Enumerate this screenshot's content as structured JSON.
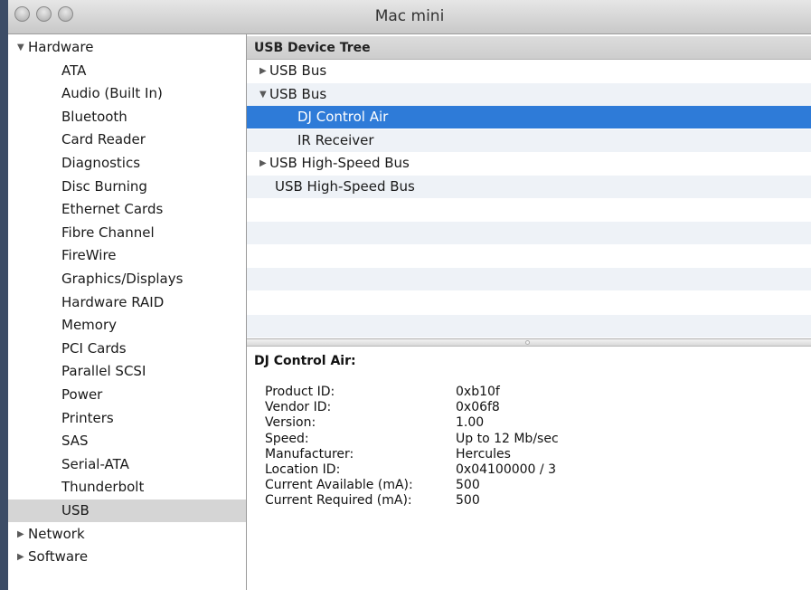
{
  "window": {
    "title": "Mac mini"
  },
  "sidebar": {
    "hardware_label": "Hardware",
    "hardware_items": [
      "ATA",
      "Audio (Built In)",
      "Bluetooth",
      "Card Reader",
      "Diagnostics",
      "Disc Burning",
      "Ethernet Cards",
      "Fibre Channel",
      "FireWire",
      "Graphics/Displays",
      "Hardware RAID",
      "Memory",
      "PCI Cards",
      "Parallel SCSI",
      "Power",
      "Printers",
      "SAS",
      "Serial-ATA",
      "Thunderbolt",
      "USB"
    ],
    "selected_item": "USB",
    "network_label": "Network",
    "software_label": "Software"
  },
  "tree": {
    "header": "USB Device Tree",
    "rows": [
      {
        "label": "USB Bus",
        "state": "collapsed"
      },
      {
        "label": "USB Bus",
        "state": "expanded"
      },
      {
        "label": "DJ Control Air",
        "state": "leaf"
      },
      {
        "label": "IR Receiver",
        "state": "leaf"
      },
      {
        "label": "USB High-Speed Bus",
        "state": "collapsed"
      },
      {
        "label": "USB High-Speed Bus",
        "state": "none"
      }
    ],
    "selected_index": 2
  },
  "detail": {
    "title": "DJ Control Air:",
    "properties": [
      {
        "key": "Product ID:",
        "value": "0xb10f"
      },
      {
        "key": "Vendor ID:",
        "value": "0x06f8"
      },
      {
        "key": "Version:",
        "value": "1.00"
      },
      {
        "key": "Speed:",
        "value": "Up to 12 Mb/sec"
      },
      {
        "key": "Manufacturer:",
        "value": "Hercules"
      },
      {
        "key": "Location ID:",
        "value": "0x04100000 / 3"
      },
      {
        "key": "Current Available (mA):",
        "value": "500"
      },
      {
        "key": "Current Required (mA):",
        "value": "500"
      }
    ]
  },
  "icons": {
    "disclosure_expanded": "▼",
    "disclosure_collapsed": "▶"
  },
  "colors": {
    "selection_blue": "#2e7bd8",
    "sidebar_selection": "#d5d5d5",
    "row_stripe": "#eef2f7"
  }
}
